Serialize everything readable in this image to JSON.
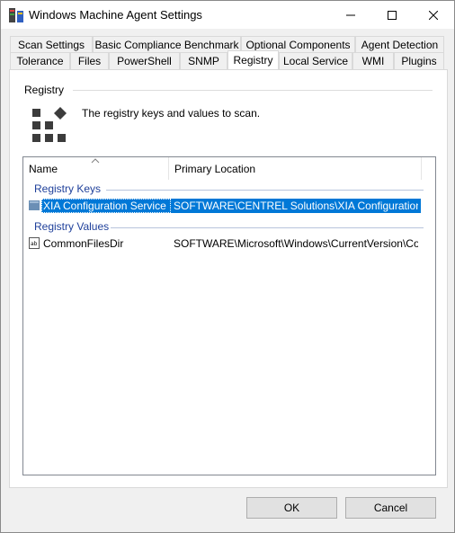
{
  "window": {
    "title": "Windows Machine Agent Settings"
  },
  "tabs": {
    "row_back": [
      "Scan Settings",
      "Basic Compliance Benchmark",
      "Optional Components",
      "Agent Detection"
    ],
    "row_front": [
      "Tolerance",
      "Files",
      "PowerShell",
      "SNMP",
      "Registry",
      "Local Service",
      "WMI",
      "Plugins"
    ],
    "active": "Registry"
  },
  "panel": {
    "group_label": "Registry",
    "description": "The registry keys and values to scan."
  },
  "listview": {
    "columns": [
      "Name",
      "Primary Location"
    ],
    "sorted_column": "Name",
    "groups": [
      {
        "title": "Registry Keys",
        "rows": [
          {
            "name": "XIA Configuration Service",
            "location": "SOFTWARE\\CENTREL Solutions\\XIA Configuration S...",
            "selected": true,
            "icon": "registry-key-icon"
          }
        ]
      },
      {
        "title": "Registry Values",
        "rows": [
          {
            "name": "CommonFilesDir",
            "location": "SOFTWARE\\Microsoft\\Windows\\CurrentVersion\\Com...",
            "selected": false,
            "icon": "registry-string-value-icon"
          }
        ]
      }
    ]
  },
  "buttons": {
    "ok": "OK",
    "cancel": "Cancel"
  },
  "colors": {
    "selection": "#0078d7",
    "group_header": "#1e3f9a"
  }
}
